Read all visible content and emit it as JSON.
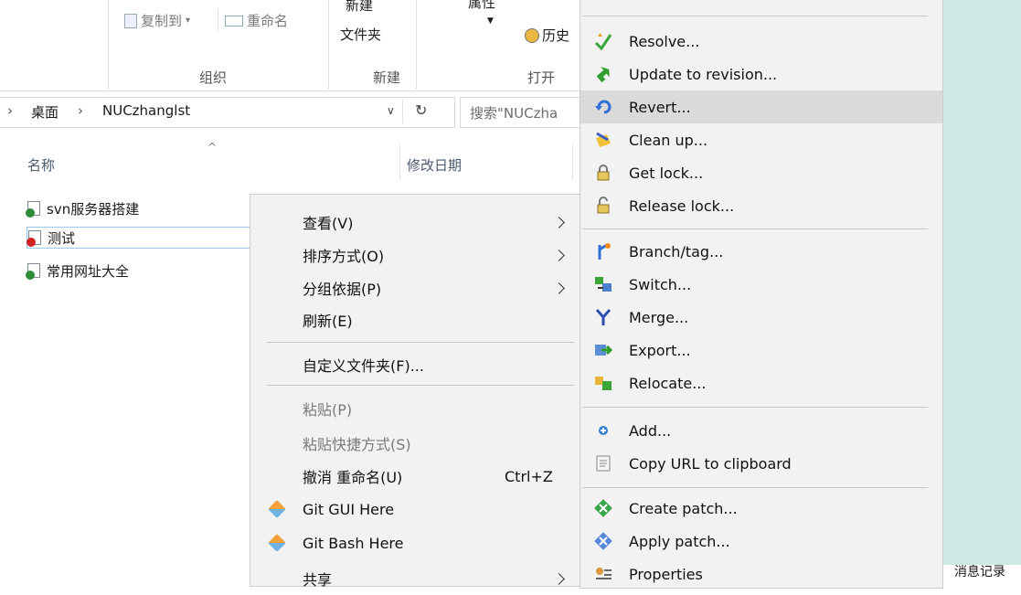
{
  "ribbon": {
    "copy_to": "复制到",
    "rename": "重命名",
    "new_top": "新建",
    "new_folder": "文件夹",
    "props_top": "属性",
    "history": "历史",
    "group_organize": "组织",
    "group_new": "新建",
    "group_open": "打开"
  },
  "address": {
    "crumb_root": "桌面",
    "crumb_sep1": "›",
    "crumb_sep0": "›",
    "crumb_folder": "NUCzhanglst",
    "search_placeholder": "搜索\"NUCzha"
  },
  "columns": {
    "name": "名称",
    "modified": "修改日期"
  },
  "files": [
    {
      "name": "svn服务器搭建",
      "badge": "#2e8b3a"
    },
    {
      "name": "测试",
      "badge": "#d32020"
    },
    {
      "name": "常用网址大全",
      "badge": "#2e8b3a"
    }
  ],
  "explorer_menu": {
    "items": [
      {
        "label": "查看(V)",
        "submenu": true
      },
      {
        "label": "排序方式(O)",
        "submenu": true
      },
      {
        "label": "分组依据(P)",
        "submenu": true
      },
      {
        "label": "刷新(E)"
      },
      {
        "label": "自定义文件夹(F)..."
      },
      {
        "label": "粘贴(P)",
        "disabled": true
      },
      {
        "label": "粘贴快捷方式(S)",
        "disabled": true
      },
      {
        "label": "撤消 重命名(U)",
        "shortcut": "Ctrl+Z"
      },
      {
        "label": "Git GUI Here",
        "icon": "git-icon"
      },
      {
        "label": "Git Bash Here",
        "icon": "git-icon"
      },
      {
        "label": "共享"
      }
    ]
  },
  "svn_menu": {
    "items": [
      {
        "label": "Resolve...",
        "icon": "resolve-icon"
      },
      {
        "label": "Update to revision...",
        "icon": "update-icon"
      },
      {
        "label": "Revert...",
        "icon": "revert-icon"
      },
      {
        "label": "Clean up...",
        "icon": "cleanup-icon"
      },
      {
        "label": "Get lock...",
        "icon": "lock-icon"
      },
      {
        "label": "Release lock...",
        "icon": "unlock-icon"
      },
      {
        "label": "Branch/tag...",
        "icon": "branch-icon"
      },
      {
        "label": "Switch...",
        "icon": "switch-icon"
      },
      {
        "label": "Merge...",
        "icon": "merge-icon"
      },
      {
        "label": "Export...",
        "icon": "export-icon"
      },
      {
        "label": "Relocate...",
        "icon": "relocate-icon"
      },
      {
        "label": "Add...",
        "icon": "add-icon"
      },
      {
        "label": "Copy URL to clipboard",
        "icon": "clipboard-icon"
      },
      {
        "label": "Create patch...",
        "icon": "create-patch-icon"
      },
      {
        "label": "Apply patch...",
        "icon": "apply-patch-icon"
      },
      {
        "label": "Properties",
        "icon": "properties-icon"
      }
    ]
  },
  "side": {
    "text": "消息记录"
  }
}
